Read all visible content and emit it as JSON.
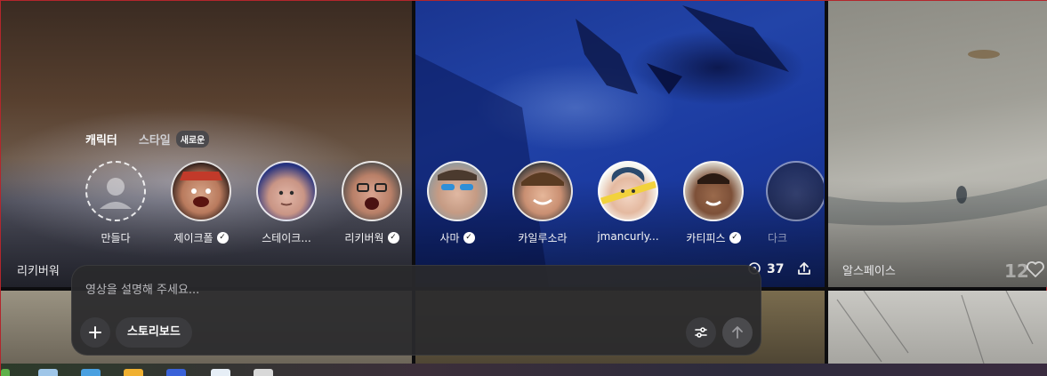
{
  "tiles": [
    {
      "author": "리키버워",
      "count": ""
    },
    {
      "author": "",
      "count": "37"
    },
    {
      "author": "알스페이스",
      "count": "12"
    }
  ],
  "char_tabs": {
    "characters": "캐릭터",
    "style": "스타일",
    "new_badge": "새로운"
  },
  "characters": [
    {
      "name": "만들다",
      "verified": false
    },
    {
      "name": "제이크폴",
      "verified": true
    },
    {
      "name": "스테이크...",
      "verified": false
    },
    {
      "name": "리키버웍",
      "verified": true
    },
    {
      "name": "사마",
      "verified": true
    },
    {
      "name": "카일루소라",
      "verified": false
    },
    {
      "name": "jmancurly...",
      "verified": false
    },
    {
      "name": "카티피스",
      "verified": true
    },
    {
      "name": "다크",
      "verified": false
    }
  ],
  "composer": {
    "placeholder": "영상을 설명해 주세요...",
    "storyboard_label": "스토리보드"
  },
  "icons": {
    "add": "plus-icon",
    "settings": "sliders-icon",
    "send": "arrow-up-icon",
    "share": "share-icon",
    "views": "eye-icon",
    "like": "heart-icon"
  }
}
